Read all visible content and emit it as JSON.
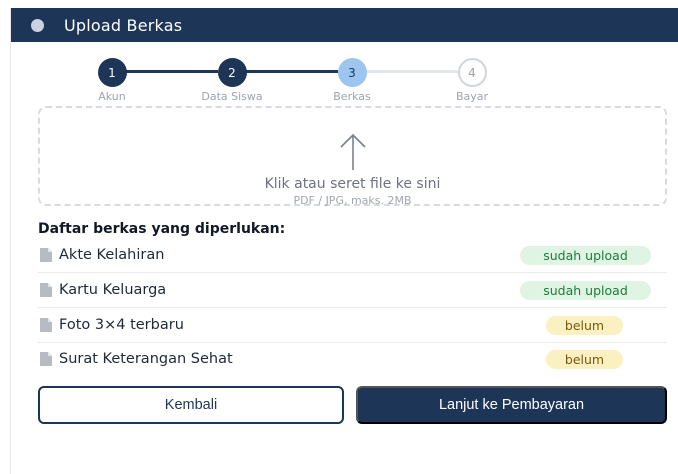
{
  "header": {
    "title": "Upload Berkas"
  },
  "stepper": {
    "steps": [
      {
        "number": "1",
        "label": "Akun",
        "state": "done"
      },
      {
        "number": "2",
        "label": "Data Siswa",
        "state": "done"
      },
      {
        "number": "3",
        "label": "Berkas",
        "state": "active"
      },
      {
        "number": "4",
        "label": "Bayar",
        "state": "todo"
      }
    ]
  },
  "dropzone": {
    "icon": "arrow-up-icon",
    "text": "Klik atau seret file ke sini",
    "hint": "PDF / JPG, maks. 2MB"
  },
  "files": {
    "title": "Daftar berkas yang diperlukan:",
    "items": [
      {
        "name": "Akte Kelahiran",
        "status": "sudah upload",
        "state": "uploaded"
      },
      {
        "name": "Kartu Keluarga",
        "status": "sudah upload",
        "state": "uploaded"
      },
      {
        "name": "Foto 3×4 terbaru",
        "status": "belum",
        "state": "pending"
      },
      {
        "name": "Surat Keterangan Sehat",
        "status": "belum",
        "state": "pending"
      }
    ]
  },
  "actions": {
    "back_label": "Kembali",
    "next_label": "Lanjut ke Pembayaran"
  },
  "colors": {
    "primary": "#1d3557",
    "active_step": "#9cc6ef",
    "success_bg": "#dff4e3",
    "pending_bg": "#fbf0c2"
  }
}
